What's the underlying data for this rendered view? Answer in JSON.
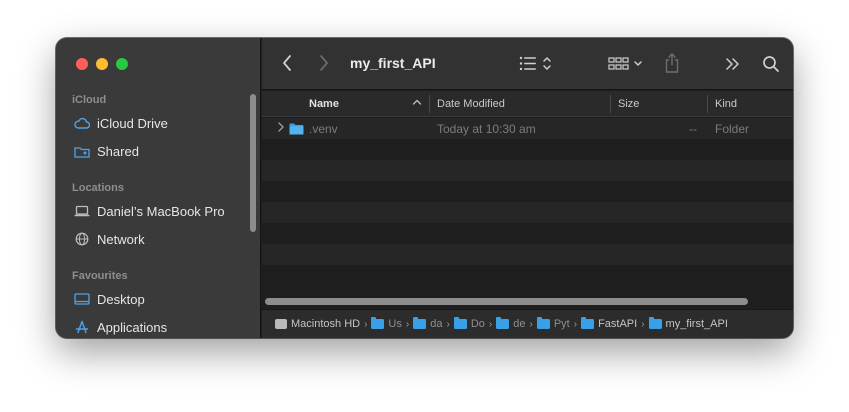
{
  "window": {
    "title": "my_first_API"
  },
  "sidebar": {
    "sections": [
      {
        "title": "iCloud"
      },
      {
        "title": "Locations"
      },
      {
        "title": "Favourites"
      }
    ],
    "items": [
      {
        "label": "iCloud Drive",
        "icon": "cloud-icon"
      },
      {
        "label": "Shared",
        "icon": "shared-folder-icon"
      },
      {
        "label": "Daniel’s MacBook Pro",
        "icon": "laptop-icon"
      },
      {
        "label": "Network",
        "icon": "globe-icon"
      },
      {
        "label": "Desktop",
        "icon": "desktop-icon"
      },
      {
        "label": "Applications",
        "icon": "applications-icon"
      }
    ]
  },
  "columns": {
    "name": "Name",
    "date": "Date Modified",
    "size": "Size",
    "kind": "Kind"
  },
  "files": [
    {
      "name": ".venv",
      "date": "Today at 10:30 am",
      "size": "--",
      "kind": "Folder"
    }
  ],
  "pathbar": [
    {
      "label": "Macintosh HD",
      "icon": "disk-icon"
    },
    {
      "label": "Us",
      "icon": "user-folder-icon"
    },
    {
      "label": "da",
      "icon": "home-folder-icon"
    },
    {
      "label": "Do",
      "icon": "folder-icon"
    },
    {
      "label": "de",
      "icon": "folder-icon"
    },
    {
      "label": "Pyt",
      "icon": "folder-icon"
    },
    {
      "label": "FastAPI",
      "icon": "folder-icon"
    },
    {
      "label": "my_first_API",
      "icon": "folder-icon"
    }
  ],
  "colors": {
    "accent_blue": "#3aa0e6",
    "close": "#ff5f57",
    "minimize": "#febc2e",
    "zoom": "#28c840"
  }
}
